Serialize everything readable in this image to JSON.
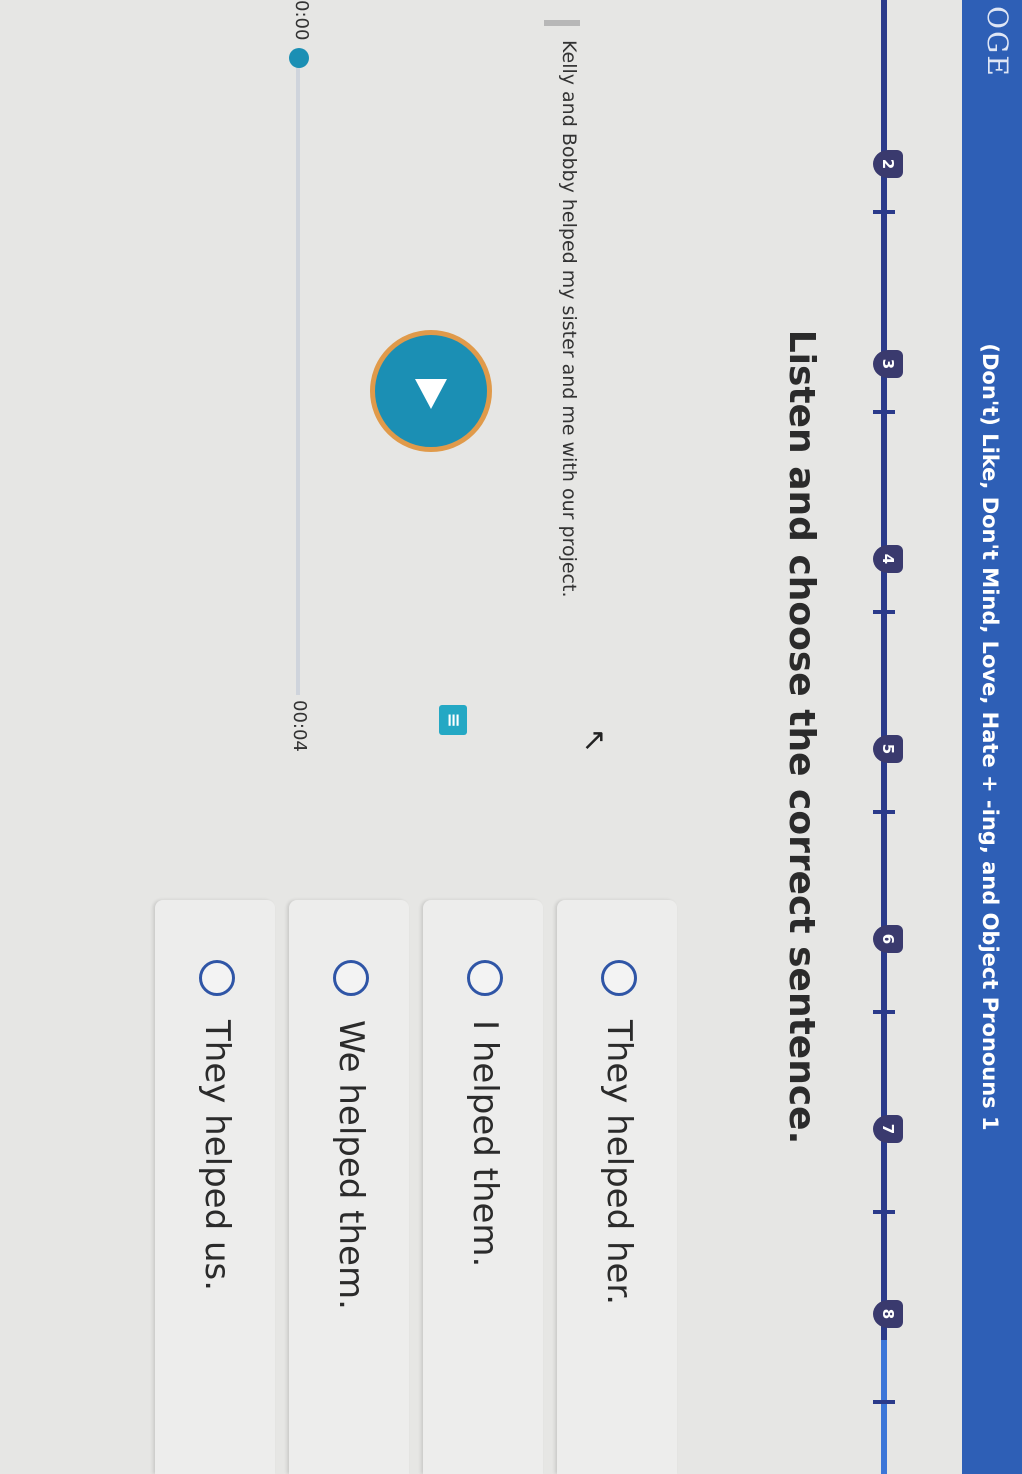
{
  "app": {
    "brand": "OGE",
    "lesson_title": "(Don't) Like, Don't Mind, Love, Hate + -ing, and Object Pronouns 1"
  },
  "progress": {
    "steps": [
      "2",
      "3",
      "4",
      "5",
      "6",
      "7",
      "8"
    ]
  },
  "instruction": "Listen and choose the correct sentence.",
  "audio": {
    "transcript": "Kelly and Bobby helped my sister and me with our project.",
    "time_current": "0:00",
    "time_total": "00:04",
    "progress_fraction": 0,
    "transcript_icon": "transcript-icon",
    "play_icon": "play-icon"
  },
  "options": [
    {
      "label": "They helped her."
    },
    {
      "label": "I helped them."
    },
    {
      "label": "We helped them."
    },
    {
      "label": "They helped us."
    }
  ],
  "colors": {
    "topbar": "#2e5fb6",
    "accent": "#1b8fb4",
    "play_ring": "#e09a4a",
    "radio": "#2f55a6"
  }
}
